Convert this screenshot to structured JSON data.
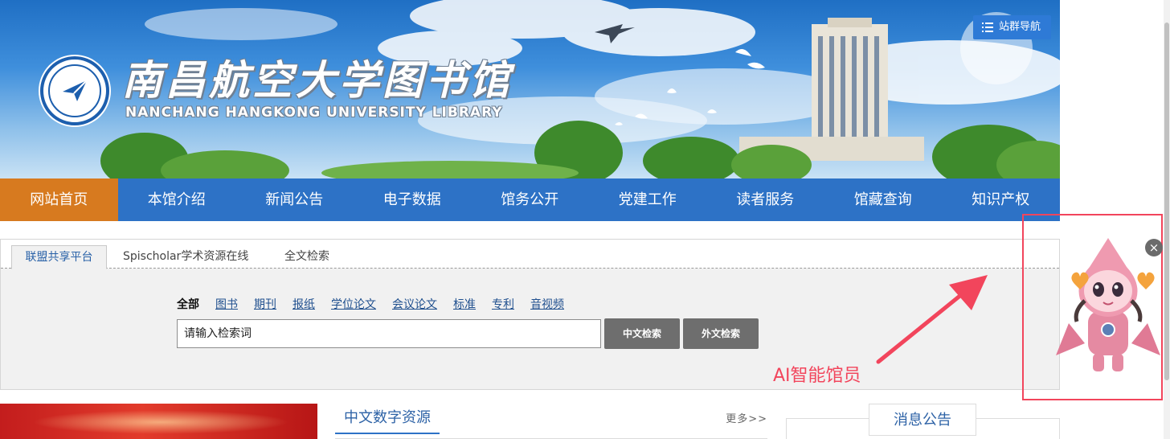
{
  "banner": {
    "logo_title": "南昌航空大学图书馆",
    "logo_subtitle": "NANCHANG HANGKONG UNIVERSITY LIBRARY",
    "site_nav_label": "站群导航",
    "site_nav_icon": "list-icon"
  },
  "main_nav": {
    "items": [
      {
        "label": "网站首页",
        "active": true
      },
      {
        "label": "本馆介绍"
      },
      {
        "label": "新闻公告"
      },
      {
        "label": "电子数据"
      },
      {
        "label": "馆务公开"
      },
      {
        "label": "党建工作"
      },
      {
        "label": "读者服务"
      },
      {
        "label": "馆藏查询"
      },
      {
        "label": "知识产权"
      }
    ],
    "active_color": "#d77a1f",
    "bar_color": "#2d72c6"
  },
  "search": {
    "tabs": [
      "联盟共享平台",
      "Spischolar学术资源在线",
      "全文检索"
    ],
    "filters": [
      "全部",
      "图书",
      "期刊",
      "报纸",
      "学位论文",
      "会议论文",
      "标准",
      "专利",
      "音视频"
    ],
    "placeholder": "请输入检索词",
    "btn_cn": "中文检索",
    "btn_foreign": "外文检索"
  },
  "content": {
    "cn_resources_title": "中文数字资源",
    "more": "更多>>",
    "notice_title": "消息公告"
  },
  "assistant": {
    "label": "AI智能馆员",
    "close_glyph": "×",
    "accent": "#f2455c"
  }
}
